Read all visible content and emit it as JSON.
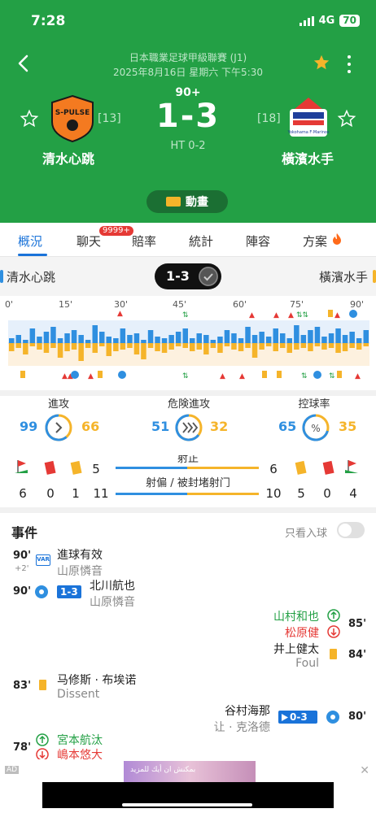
{
  "status": {
    "time": "7:28",
    "network": "4G",
    "battery": "70"
  },
  "header": {
    "league": "日本職業足球甲級聯賽 (J1)",
    "datetime": "2025年8月16日 星期六 下午5:30",
    "minute": "90+",
    "score": "1-3",
    "halftime": "HT 0-2",
    "home": {
      "name": "清水心跳",
      "rank": "[13]",
      "logo_text": "S-PULSE",
      "logo_color": "#f47a20"
    },
    "away": {
      "name": "橫濱水手",
      "rank": "[18]",
      "logo_text": "Yokohama F·Marinos",
      "logo_color": "#1f3f9b"
    },
    "animation_label": "動畫"
  },
  "tabs": [
    {
      "label": "概況",
      "active": true
    },
    {
      "label": "聊天",
      "badge": "9999+"
    },
    {
      "label": "賠率"
    },
    {
      "label": "統計"
    },
    {
      "label": "陣容"
    },
    {
      "label": "方案"
    }
  ],
  "summary": {
    "home": "清水心跳",
    "away": "橫濱水手",
    "score": "1-3"
  },
  "timeline": {
    "ticks": [
      "0'",
      "15'",
      "30'",
      "45'",
      "60'",
      "75'",
      "90'"
    ],
    "home_color": "#2f8fe0",
    "away_color": "#f5b42a"
  },
  "stats": {
    "attack": {
      "label": "進攻",
      "home": "99",
      "away": "66"
    },
    "danger": {
      "label": "危険進攻",
      "home": "51",
      "away": "32"
    },
    "possession": {
      "label": "控球率",
      "home": "65",
      "away": "35"
    },
    "on_target": {
      "label": "射正",
      "home": "5",
      "away": "6"
    },
    "off_target": {
      "label": "射偏 / 被封堵射门",
      "home": "11",
      "away": "10"
    },
    "home_corners": "6",
    "home_red": "0",
    "home_yellow": "1",
    "away_yellow": "5",
    "away_red": "0",
    "away_corners": "4"
  },
  "events": {
    "title": "事件",
    "filter_label": "只看入球",
    "items": [
      {
        "minute": "90'",
        "sub": "+2'",
        "main": "進球有效",
        "second": "山原憐音"
      },
      {
        "minute": "90'",
        "chip": "1-3",
        "main": "北川航也",
        "second": "山原憐音"
      },
      {
        "minute": "85'",
        "in": "山村和也",
        "out": "松原健"
      },
      {
        "minute": "84'",
        "main": "井上健太",
        "second": "Foul"
      },
      {
        "minute": "83'",
        "main": "马修斯 · 布埃诺",
        "second": "Dissent"
      },
      {
        "minute": "80'",
        "chip": "0-3",
        "main": "谷村海那",
        "second": "让 · 克洛德"
      },
      {
        "minute": "78'",
        "in": "宮本航汰",
        "out": "嶋本悠大"
      }
    ]
  },
  "ad": {
    "label": "AD",
    "banner_text": "بمكنش ان أيك للمزيد"
  }
}
